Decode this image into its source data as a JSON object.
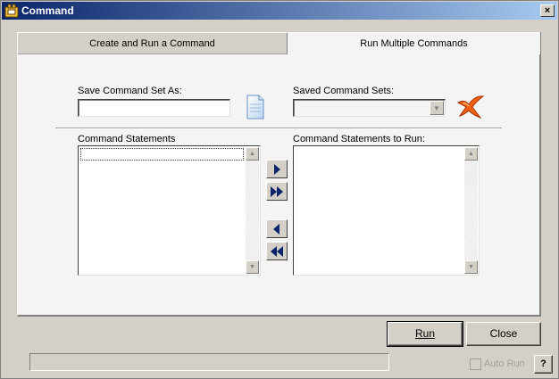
{
  "window": {
    "title": "Command",
    "close_glyph": "×"
  },
  "tabs": [
    {
      "label": "Create and Run a Command",
      "active": false
    },
    {
      "label": "Run Multiple Commands",
      "active": true
    }
  ],
  "save_set": {
    "label": "Save Command Set As:",
    "value": ""
  },
  "saved_sets": {
    "label": "Saved Command Sets:",
    "selected": ""
  },
  "lists": {
    "statements_label": "Command Statements",
    "to_run_label": "Command Statements to Run:"
  },
  "buttons": {
    "run_label": "Run",
    "close_label": "Close",
    "help_label": "?"
  },
  "auto_run": {
    "label": "Auto Run",
    "checked": false,
    "enabled": false
  },
  "icons": {
    "app": "command-icon",
    "save": "save-document-icon",
    "delete": "delete-x-icon",
    "move_right": "move-right-icon",
    "move_all_right": "move-all-right-icon",
    "move_left": "move-left-icon",
    "move_all_left": "move-all-left-icon"
  },
  "colors": {
    "title_start": "#0a246a",
    "title_end": "#a6caf0",
    "arrow_blue": "#0a246a",
    "delete_orange": "#f06010"
  }
}
